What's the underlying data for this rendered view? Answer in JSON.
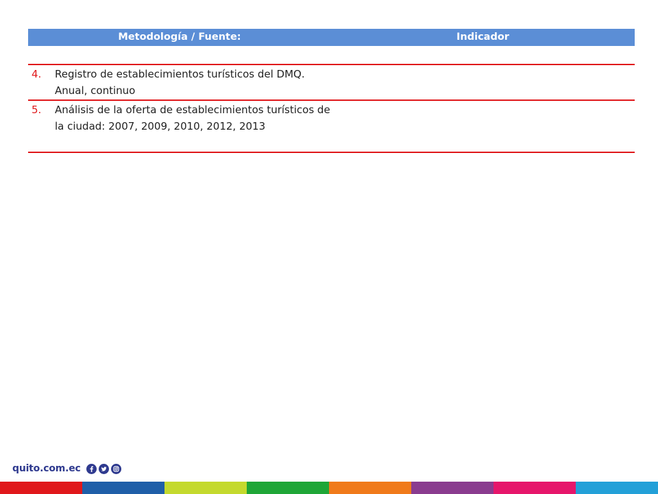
{
  "table": {
    "header": {
      "col_methodology": "Metodología / Fuente:",
      "col_indicator": "Indicador"
    },
    "header_color": "#5b8ed6",
    "rule_color": "#e0181b",
    "rows": [
      {
        "number": "4.",
        "line1": "Registro de establecimientos turísticos del DMQ.",
        "line2": "Anual, continuo"
      },
      {
        "number": "5.",
        "line1": "Análisis de la oferta de establecimientos turísticos de",
        "line2": "la ciudad: 2007, 2009, 2010, 2012, 2013"
      }
    ]
  },
  "footer": {
    "site": "quito.com.ec",
    "social_icons": [
      "facebook-icon",
      "twitter-icon",
      "instagram-icon"
    ],
    "brand_color": "#2f3a8f",
    "stripe_colors": [
      "#e0181b",
      "#1f5fa8",
      "#c4d92e",
      "#1fa637",
      "#f07a1a",
      "#8a3c8f",
      "#e6166b",
      "#23a0d8"
    ]
  }
}
